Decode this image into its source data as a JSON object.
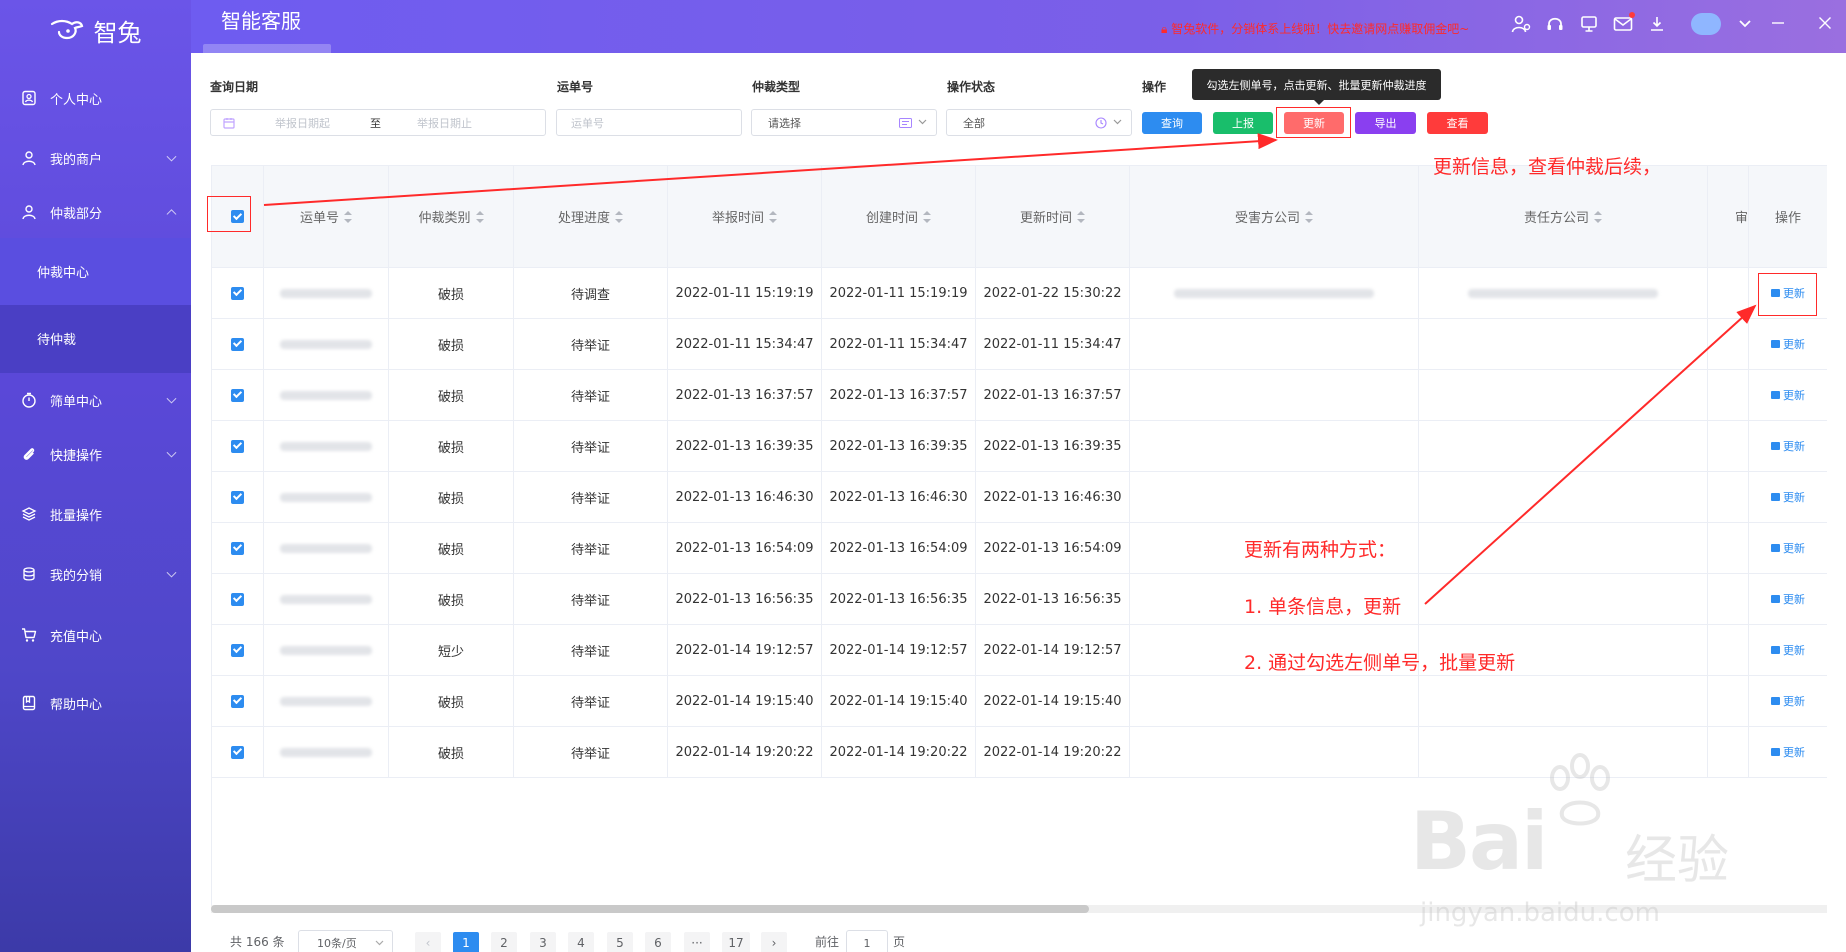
{
  "sidebar": {
    "logo_text": "智兔",
    "items": [
      {
        "label": "个人中心"
      },
      {
        "label": "我的商户"
      },
      {
        "label": "仲裁部分"
      },
      {
        "label": "筛单中心"
      },
      {
        "label": "快捷操作"
      },
      {
        "label": "批量操作"
      },
      {
        "label": "我的分销"
      },
      {
        "label": "充值中心"
      },
      {
        "label": "帮助中心"
      }
    ],
    "sub_items": [
      {
        "label": "仲裁中心"
      },
      {
        "label": "待仲裁"
      }
    ]
  },
  "header": {
    "title": "智能客服",
    "notice": "智兔软件，分销体系上线啦！快去邀请网点赚取佣金吧~"
  },
  "filters": {
    "query_date_label": "查询日期",
    "date_start_placeholder": "举报日期起",
    "date_sep": "至",
    "date_end_placeholder": "举报日期止",
    "waybill_label": "运单号",
    "waybill_placeholder": "运单号",
    "type_label": "仲裁类型",
    "type_value": "请选择",
    "status_label": "操作状态",
    "status_value": "全部",
    "ops_label": "操作",
    "buttons": {
      "query": "查询",
      "report": "上报",
      "update": "更新",
      "export": "导出",
      "view": "查看"
    },
    "tooltip": "勾选左侧单号，点击更新、批量更新仲裁进度"
  },
  "table": {
    "headers": [
      "运单号",
      "仲裁类别",
      "处理进度",
      "举报时间",
      "创建时间",
      "更新时间",
      "受害方公司",
      "责任方公司",
      "审",
      "操作"
    ],
    "op_label": "更新",
    "rows": [
      {
        "type": "破损",
        "progress": "待调查",
        "report": "2022-01-11 15:19:19",
        "created": "2022-01-11 15:19:19",
        "updated": "2022-01-22 15:30:22"
      },
      {
        "type": "破损",
        "progress": "待举证",
        "report": "2022-01-11 15:34:47",
        "created": "2022-01-11 15:34:47",
        "updated": "2022-01-11 15:34:47"
      },
      {
        "type": "破损",
        "progress": "待举证",
        "report": "2022-01-13 16:37:57",
        "created": "2022-01-13 16:37:57",
        "updated": "2022-01-13 16:37:57"
      },
      {
        "type": "破损",
        "progress": "待举证",
        "report": "2022-01-13 16:39:35",
        "created": "2022-01-13 16:39:35",
        "updated": "2022-01-13 16:39:35"
      },
      {
        "type": "破损",
        "progress": "待举证",
        "report": "2022-01-13 16:46:30",
        "created": "2022-01-13 16:46:30",
        "updated": "2022-01-13 16:46:30"
      },
      {
        "type": "破损",
        "progress": "待举证",
        "report": "2022-01-13 16:54:09",
        "created": "2022-01-13 16:54:09",
        "updated": "2022-01-13 16:54:09"
      },
      {
        "type": "破损",
        "progress": "待举证",
        "report": "2022-01-13 16:56:35",
        "created": "2022-01-13 16:56:35",
        "updated": "2022-01-13 16:56:35"
      },
      {
        "type": "短少",
        "progress": "待举证",
        "report": "2022-01-14 19:12:57",
        "created": "2022-01-14 19:12:57",
        "updated": "2022-01-14 19:12:57"
      },
      {
        "type": "破损",
        "progress": "待举证",
        "report": "2022-01-14 19:15:40",
        "created": "2022-01-14 19:15:40",
        "updated": "2022-01-14 19:15:40"
      },
      {
        "type": "破损",
        "progress": "待举证",
        "report": "2022-01-14 19:20:22",
        "created": "2022-01-14 19:20:22",
        "updated": "2022-01-14 19:20:22"
      }
    ]
  },
  "pagination": {
    "total": "共 166 条",
    "page_size": "10条/页",
    "prev": "‹",
    "next": "›",
    "pages": [
      "1",
      "2",
      "3",
      "4",
      "5",
      "6",
      "···",
      "17"
    ],
    "goto_prefix": "前往",
    "goto_value": "1",
    "goto_suffix": "页"
  },
  "annotations": {
    "top_note": "更新信息，查看仲裁后续，",
    "methods_title": "更新有两种方式：",
    "method1": "1. 单条信息，更新",
    "method2": "2. 通过勾选左侧单号，批量更新"
  },
  "watermark": {
    "brand": "Bai",
    "brand_cn": "经验",
    "url": "jingyan.baidu.com"
  },
  "colors": {
    "primary": "#2d8cf0",
    "sidebar": "#5a48d8",
    "annotation": "#ff2a2a",
    "btn_query": "#2d8cf0",
    "btn_report": "#19be6b",
    "btn_update": "#ff6b6b",
    "btn_export": "#8a3ff0",
    "btn_view": "#ff3b3b"
  }
}
